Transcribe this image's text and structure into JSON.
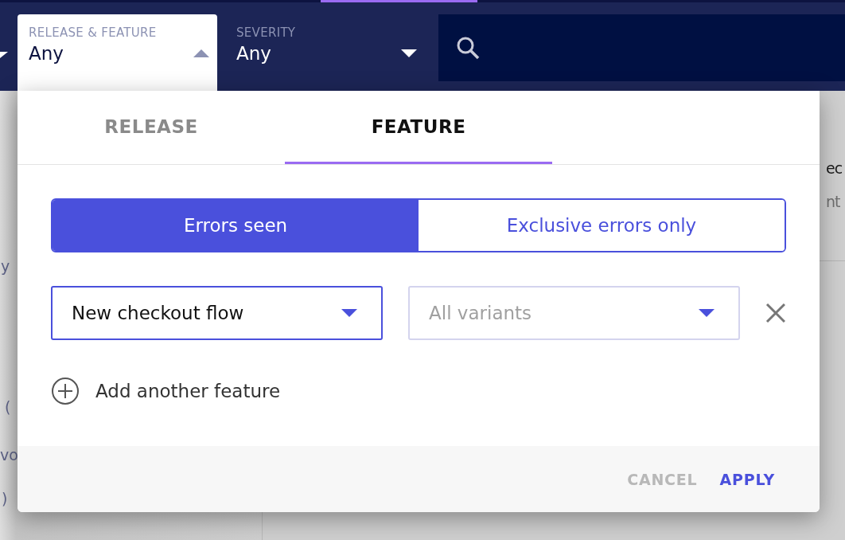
{
  "filter_bar": {
    "filters": [
      {
        "label": "RELEASE & FEATURE",
        "value": "Any",
        "expanded": true
      },
      {
        "label": "SEVERITY",
        "value": "Any",
        "expanded": false
      }
    ]
  },
  "background": {
    "left_fragments": [
      "y",
      "(",
      "vo",
      ")"
    ],
    "right_fragments": [
      "ec",
      "nt"
    ]
  },
  "popup": {
    "tabs": [
      {
        "label": "RELEASE",
        "selected": false
      },
      {
        "label": "FEATURE",
        "selected": true
      }
    ],
    "mode_toggle": [
      {
        "label": "Errors seen",
        "selected": true
      },
      {
        "label": "Exclusive errors only",
        "selected": false
      }
    ],
    "feature_select": {
      "value": "New checkout flow"
    },
    "variant_select": {
      "placeholder": "All variants"
    },
    "add_link": "Add another feature",
    "buttons": [
      {
        "label": "CANCEL",
        "disabled": true
      },
      {
        "label": "APPLY",
        "disabled": false
      }
    ]
  }
}
